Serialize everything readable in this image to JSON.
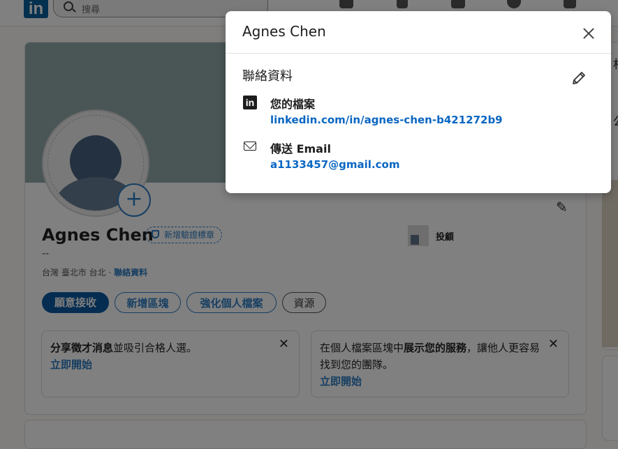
{
  "topnav": {
    "logo": "in",
    "search_placeholder": "搜尋"
  },
  "profile": {
    "name": "Agnes Chen",
    "verify_badge": "新增驗證標章",
    "headline": "--",
    "location": "台灣 臺北市 台北",
    "contact_link": "聯絡資料",
    "investor_label": "投顧"
  },
  "actions": {
    "open_to": "願意接收",
    "add_section": "新增區塊",
    "enhance": "強化個人檔案",
    "resources": "資源"
  },
  "notes": [
    {
      "bold": "分享徵才消息",
      "text": "並吸引合格人選。",
      "link": "立即開始"
    },
    {
      "pre": "在個人檔案區塊中",
      "bold": "展示您的服務",
      "text": "，讓他人更容易找到您的團隊。",
      "link": "立即開始"
    }
  ],
  "right_column_peek": {
    "line1": "相",
    "line2": "公"
  },
  "modal": {
    "title": "Agnes Chen",
    "section": "聯絡資料",
    "profile_label": "您的檔案",
    "profile_url": "linkedin.com/in/agnes-chen-b421272b9",
    "email_label": "傳送 Email",
    "email": "a1133457@gmail.com"
  },
  "colors": {
    "link_blue": "#0a66c2",
    "overlay_dim": "#808080",
    "brand_dark": "#052d52"
  },
  "icons": [
    "search-icon",
    "home-icon",
    "people-icon",
    "briefcase-icon",
    "message-icon",
    "bell-icon",
    "shield-icon",
    "plus-icon",
    "pencil-icon",
    "linkedin-icon",
    "mail-icon",
    "close-icon"
  ]
}
